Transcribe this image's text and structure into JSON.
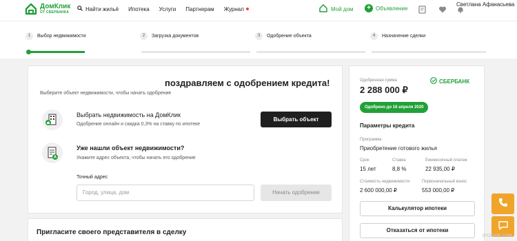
{
  "header": {
    "logo": {
      "name": "ДомКлик",
      "sub": "ОТ СБЕРБАНКА"
    },
    "nav": [
      {
        "label": "Найти жильё"
      },
      {
        "label": "Ипотека"
      },
      {
        "label": "Услуги"
      },
      {
        "label": "Партнерам"
      },
      {
        "label": "Журнал"
      }
    ],
    "my_home": "Мой дом",
    "ad": "Объявление",
    "user": "Светлана Афанасьева",
    "accent": "#21a038"
  },
  "steps": {
    "items": [
      {
        "num": "1",
        "label": "Выбор недвижимости"
      },
      {
        "num": "2",
        "label": "Загрузка документов"
      },
      {
        "num": "3",
        "label": "Одобрение объекта"
      },
      {
        "num": "4",
        "label": "Назначение сделки"
      }
    ],
    "active": 1
  },
  "main": {
    "title": "поздравляем с одобрением кредита!",
    "subtitle": "Выберите объект недвижимости, чтобы начать одобрение",
    "option1": {
      "title": "Выбрать недвижимость на ДомКлик",
      "desc": "Одобрение онлайн и скидка 0,3% на ставку по ипотеке",
      "button": "Выбрать объект"
    },
    "option2": {
      "title": "Уже нашли объект недвижимости?",
      "desc": "Укажите адрес объекта, чтобы начать его одобрение"
    },
    "address": {
      "label": "Точный адрес",
      "placeholder": "Город, улица, дом",
      "button": "Начать одобрение"
    }
  },
  "invite": {
    "title": "Пригласите своего представителя в сделку"
  },
  "side": {
    "approved_label": "Одобренная сумма",
    "amount": "2 288 000 ₽",
    "bank": "СБЕРБАНК",
    "badge": "Одобрено до 16 апреля 2020",
    "params_title": "Параметры кредита",
    "program_label": "Программа",
    "program_value": "Приобретение готового жилья",
    "term_label": "Срок",
    "term_value": "15 лет",
    "rate_label": "Ставка",
    "rate_value": "8,8 %",
    "payment_label": "Ежемесячный платеж",
    "payment_value": "22 935,00 ₽",
    "cost_label": "Стоимость недвижимости",
    "cost_value": "2 600 000,00 ₽",
    "down_label": "Первоначальный взнос",
    "down_value": "553 000,00 ₽",
    "calc_button": "Калькулятор ипотеки",
    "decline_button": "Отказаться от ипотеки"
  },
  "watermark": "OTZOVIK.COM"
}
